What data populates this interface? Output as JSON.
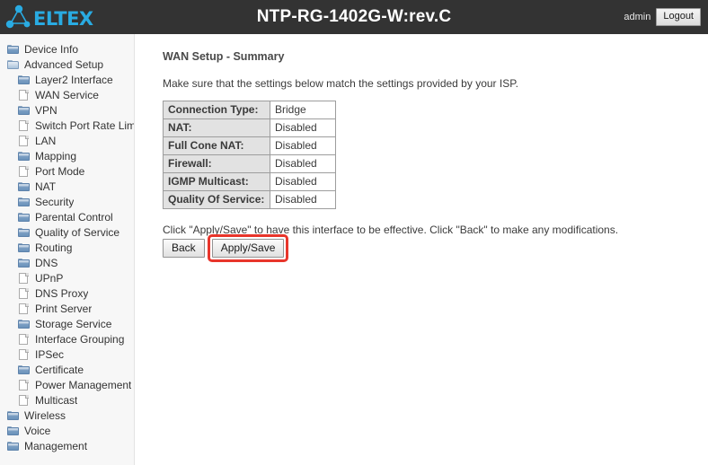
{
  "header": {
    "logo_text": "eltex",
    "logo_icon": "molecule-icon",
    "title": "NTP-RG-1402G-W:rev.C",
    "user": "admin",
    "logout_label": "Logout",
    "background_color": "#333333",
    "logo_color": "#29abe2"
  },
  "sidebar": {
    "items": [
      {
        "label": "Device Info",
        "icon": "folder-icon",
        "level": 0
      },
      {
        "label": "Advanced Setup",
        "icon": "folder-open-icon",
        "level": 0
      },
      {
        "label": "Layer2 Interface",
        "icon": "folder-icon",
        "level": 1
      },
      {
        "label": "WAN Service",
        "icon": "page-icon",
        "level": 1
      },
      {
        "label": "VPN",
        "icon": "folder-icon",
        "level": 1
      },
      {
        "label": "Switch Port Rate Limiting",
        "icon": "page-icon",
        "level": 1
      },
      {
        "label": "LAN",
        "icon": "page-icon",
        "level": 1
      },
      {
        "label": "Mapping",
        "icon": "folder-icon",
        "level": 1
      },
      {
        "label": "Port Mode",
        "icon": "page-icon",
        "level": 1
      },
      {
        "label": "NAT",
        "icon": "folder-icon",
        "level": 1
      },
      {
        "label": "Security",
        "icon": "folder-icon",
        "level": 1
      },
      {
        "label": "Parental Control",
        "icon": "folder-icon",
        "level": 1
      },
      {
        "label": "Quality of Service",
        "icon": "folder-icon",
        "level": 1
      },
      {
        "label": "Routing",
        "icon": "folder-icon",
        "level": 1
      },
      {
        "label": "DNS",
        "icon": "folder-icon",
        "level": 1
      },
      {
        "label": "UPnP",
        "icon": "page-icon",
        "level": 1
      },
      {
        "label": "DNS Proxy",
        "icon": "page-icon",
        "level": 1
      },
      {
        "label": "Print Server",
        "icon": "page-icon",
        "level": 1
      },
      {
        "label": "Storage Service",
        "icon": "folder-icon",
        "level": 1
      },
      {
        "label": "Interface Grouping",
        "icon": "page-icon",
        "level": 1
      },
      {
        "label": "IPSec",
        "icon": "page-icon",
        "level": 1
      },
      {
        "label": "Certificate",
        "icon": "folder-icon",
        "level": 1
      },
      {
        "label": "Power Management",
        "icon": "page-icon",
        "level": 1
      },
      {
        "label": "Multicast",
        "icon": "page-icon",
        "level": 1
      },
      {
        "label": "Wireless",
        "icon": "folder-icon",
        "level": 0
      },
      {
        "label": "Voice",
        "icon": "folder-icon",
        "level": 0
      },
      {
        "label": "Management",
        "icon": "folder-icon",
        "level": 0
      }
    ]
  },
  "main": {
    "title": "WAN Setup - Summary",
    "intro": "Make sure that the settings below match the settings provided by your ISP.",
    "summary_rows": [
      {
        "label": "Connection Type:",
        "value": "Bridge"
      },
      {
        "label": "NAT:",
        "value": "Disabled"
      },
      {
        "label": "Full Cone NAT:",
        "value": "Disabled"
      },
      {
        "label": "Firewall:",
        "value": "Disabled"
      },
      {
        "label": "IGMP Multicast:",
        "value": "Disabled"
      },
      {
        "label": "Quality Of Service:",
        "value": "Disabled"
      }
    ],
    "action_note": "Click \"Apply/Save\" to have this interface to be effective. Click \"Back\" to make any modifications.",
    "back_label": "Back",
    "apply_save_label": "Apply/Save",
    "highlight_color": "#e8352b"
  }
}
